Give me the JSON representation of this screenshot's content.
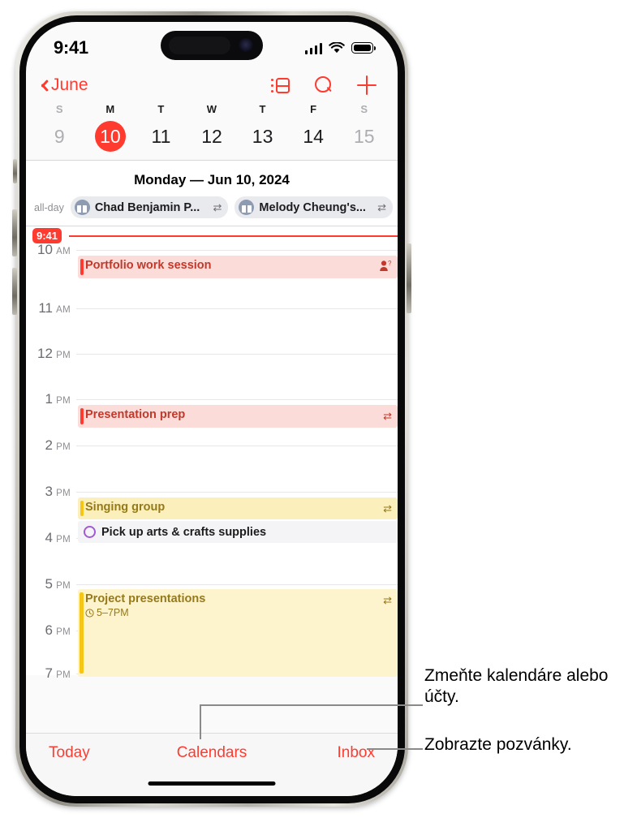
{
  "status_bar": {
    "time": "9:41",
    "signal_icon": "cellular-signal-icon",
    "wifi_icon": "wifi-icon",
    "battery_icon": "battery-icon"
  },
  "nav": {
    "back_label": "June",
    "list_view_icon": "list-view-icon",
    "search_icon": "search-icon",
    "add_icon": "plus-icon"
  },
  "week": {
    "dows": [
      "S",
      "M",
      "T",
      "W",
      "T",
      "F",
      "S"
    ],
    "days": [
      {
        "num": "9",
        "dim": true,
        "selected": false
      },
      {
        "num": "10",
        "dim": false,
        "selected": true
      },
      {
        "num": "11",
        "dim": false,
        "selected": false
      },
      {
        "num": "12",
        "dim": false,
        "selected": false
      },
      {
        "num": "13",
        "dim": false,
        "selected": false
      },
      {
        "num": "14",
        "dim": false,
        "selected": false
      },
      {
        "num": "15",
        "dim": true,
        "selected": false
      }
    ],
    "selected_color": "#ff3b30"
  },
  "day": {
    "header": "Monday — Jun 10, 2024",
    "allday_label": "all-day",
    "allday_events": [
      {
        "title": "Chad Benjamin P...",
        "icon": "gift-icon",
        "repeat_icon": "⇄"
      },
      {
        "title": "Melody Cheung's...",
        "icon": "gift-icon",
        "repeat_icon": "⇄"
      }
    ]
  },
  "timeline": {
    "now_time": "9:41",
    "hours": [
      {
        "num": "10",
        "ampm": "AM"
      },
      {
        "num": "11",
        "ampm": "AM"
      },
      {
        "num": "12",
        "ampm": "PM"
      },
      {
        "num": "1",
        "ampm": "PM"
      },
      {
        "num": "2",
        "ampm": "PM"
      },
      {
        "num": "3",
        "ampm": "PM"
      },
      {
        "num": "4",
        "ampm": "PM"
      },
      {
        "num": "5",
        "ampm": "PM"
      },
      {
        "num": "6",
        "ampm": "PM"
      },
      {
        "num": "7",
        "ampm": "PM"
      }
    ],
    "events": [
      {
        "title": "Portfolio work session",
        "detail": "",
        "badge": "person-question-icon",
        "color": "red"
      },
      {
        "title": "Presentation prep",
        "detail": "",
        "badge": "⇄",
        "color": "red"
      },
      {
        "title": "Singing group",
        "detail": "",
        "badge": "⇄",
        "color": "yellow"
      },
      {
        "title": "Project presentations",
        "detail": "5–7PM",
        "badge": "⇄",
        "color": "yellow-block"
      }
    ],
    "reminder": {
      "title": "Pick up arts & crafts supplies",
      "circle_color": "#a259d9"
    }
  },
  "tabbar": {
    "today": "Today",
    "calendars": "Calendars",
    "inbox": "Inbox"
  },
  "callouts": {
    "calendars_note": "Zmeňte kalendáre alebo účty.",
    "inbox_note": "Zobrazte pozvánky."
  }
}
